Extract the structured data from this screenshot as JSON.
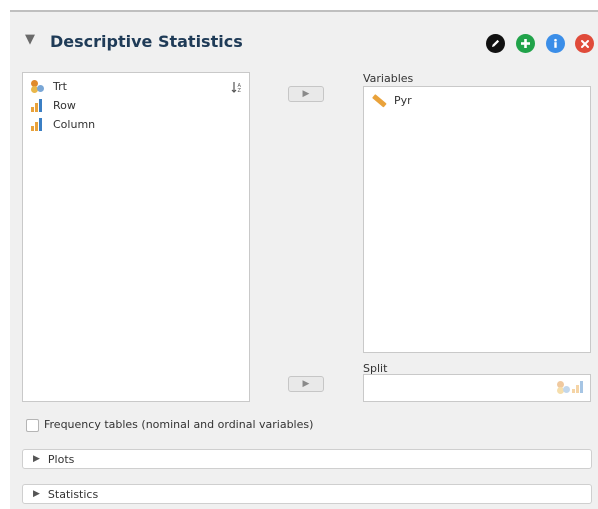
{
  "header": {
    "title": "Descriptive Statistics",
    "collapse_glyph": "▼",
    "icons": [
      "edit-icon",
      "add-icon",
      "info-icon",
      "close-icon"
    ]
  },
  "source_list": {
    "items": [
      {
        "label": "Trt",
        "type": "nominal"
      },
      {
        "label": "Row",
        "type": "ordinal"
      },
      {
        "label": "Column",
        "type": "ordinal"
      }
    ],
    "sort_icon": "sort-icon"
  },
  "assign_button_glyph": "▶",
  "variables": {
    "label": "Variables",
    "items": [
      {
        "label": "Pyr",
        "type": "scale"
      }
    ]
  },
  "split": {
    "label": "Split"
  },
  "options": {
    "frequency_tables_label": "Frequency tables (nominal and ordinal variables)",
    "frequency_tables_checked": false
  },
  "sections": [
    {
      "label": "Plots"
    },
    {
      "label": "Statistics"
    }
  ],
  "colors": {
    "title": "#1f3b57",
    "add": "#21a34a",
    "info": "#3b8ee8",
    "close": "#e04b3a",
    "nominal": "#e08a2c",
    "ordinal": "#e9a23b",
    "scale": "#e9a23b"
  }
}
